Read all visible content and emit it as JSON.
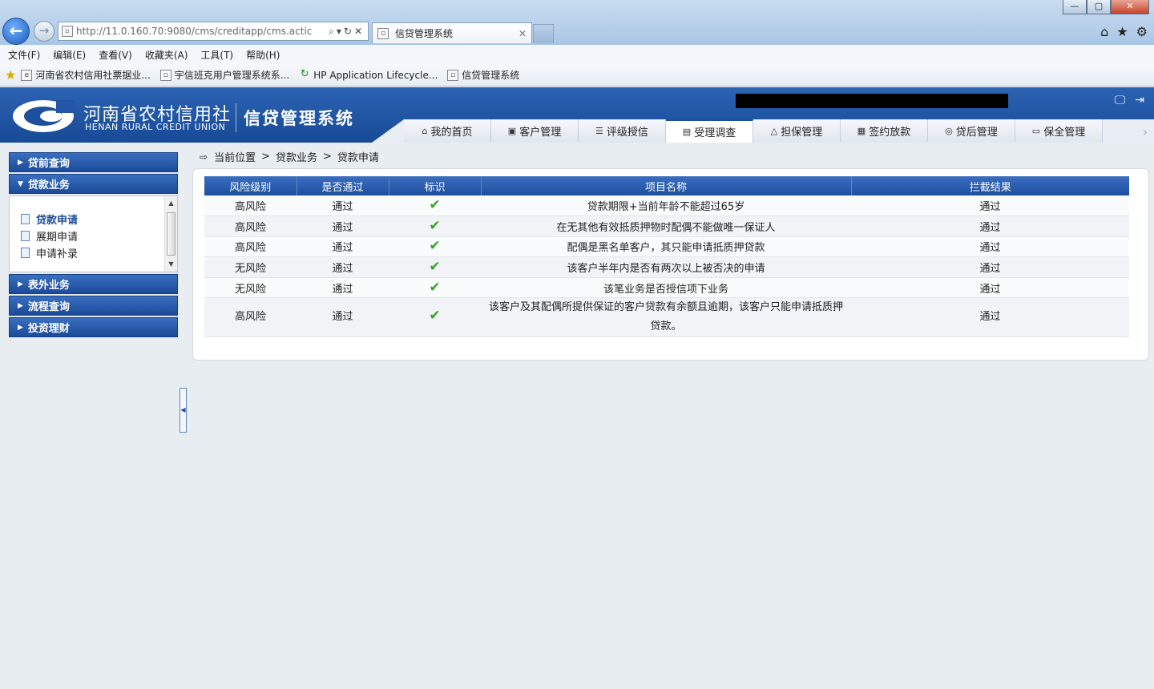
{
  "browser": {
    "url": "http://11.0.160.70:9080/cms/creditapp/cms.actic",
    "tab_title": "信贷管理系统",
    "window_controls": [
      "—",
      "▢",
      "✕"
    ],
    "menu": [
      "文件(F)",
      "编辑(E)",
      "查看(V)",
      "收藏夹(A)",
      "工具(T)",
      "帮助(H)"
    ],
    "favorites": [
      "河南省农村信用社票据业...",
      "宇信班克用户管理系统系...",
      "HP Application Lifecycle...",
      "信贷管理系统"
    ]
  },
  "header": {
    "logo_cn": "河南省农村信用社",
    "logo_en": "HENAN RURAL CREDIT UNION",
    "system_name": "信贷管理系统",
    "nav_tabs": [
      "我的首页",
      "客户管理",
      "评级授信",
      "受理调查",
      "担保管理",
      "签约放款",
      "贷后管理",
      "保全管理"
    ],
    "active_tab": "受理调查"
  },
  "sidebar": {
    "groups": [
      {
        "label": "贷前查询"
      },
      {
        "label": "贷款业务"
      },
      {
        "label": "表外业务"
      },
      {
        "label": "流程查询"
      },
      {
        "label": "投资理财"
      }
    ],
    "items": [
      "贷款申请",
      "展期申请",
      "申请补录"
    ],
    "active_item": "贷款申请"
  },
  "breadcrumb": {
    "prefix": "当前位置",
    "separator": ">",
    "levels": [
      "贷款业务",
      "贷款申请"
    ]
  },
  "table": {
    "headers": [
      "风险级别",
      "是否通过",
      "标识",
      "项目名称",
      "拦截结果"
    ],
    "check_glyph": "✔",
    "rows": [
      {
        "risk": "高风险",
        "pass": "通过",
        "name": "贷款期限+当前年龄不能超过65岁",
        "result": "通过"
      },
      {
        "risk": "高风险",
        "pass": "通过",
        "name": "在无其他有效抵质押物时配偶不能做唯一保证人",
        "result": "通过"
      },
      {
        "risk": "高风险",
        "pass": "通过",
        "name": "配偶是黑名单客户，其只能申请抵质押贷款",
        "result": "通过"
      },
      {
        "risk": "无风险",
        "pass": "通过",
        "name": "该客户半年内是否有两次以上被否决的申请",
        "result": "通过"
      },
      {
        "risk": "无风险",
        "pass": "通过",
        "name": "该笔业务是否授信项下业务",
        "result": "通过"
      },
      {
        "risk": "高风险",
        "pass": "通过",
        "name": "该客户及其配偶所提供保证的客户贷款有余额且逾期，该客户只能申请抵质押贷款。",
        "result": "通过"
      }
    ]
  }
}
